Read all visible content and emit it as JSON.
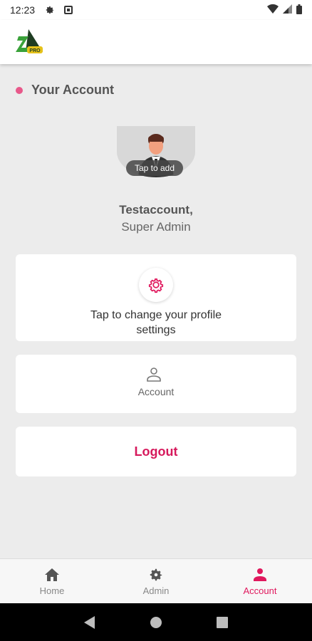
{
  "status_bar": {
    "time": "12:23",
    "icons": [
      "settings-icon",
      "notification-icon",
      "wifi-icon",
      "signal-icon",
      "battery-icon"
    ]
  },
  "header": {
    "logo": "app-logo"
  },
  "section": {
    "title": "Your Account",
    "dot_color": "#e8588a"
  },
  "profile": {
    "avatar_label": "Tap to add",
    "name": "Testaccount,",
    "role": "Super Admin"
  },
  "cards": {
    "settings_text": "Tap to change your profile settings",
    "account_text": "Account",
    "logout_text": "Logout"
  },
  "bottom_nav": {
    "items": [
      {
        "label": "Home",
        "icon": "home-icon"
      },
      {
        "label": "Admin",
        "icon": "gear-icon"
      },
      {
        "label": "Account",
        "icon": "person-icon"
      }
    ],
    "active": "Account"
  },
  "colors": {
    "accent": "#e0185d",
    "background": "#ececec",
    "card": "#ffffff"
  },
  "system_nav": {
    "buttons": [
      "back-icon",
      "home-circle-icon",
      "recents-icon"
    ]
  }
}
